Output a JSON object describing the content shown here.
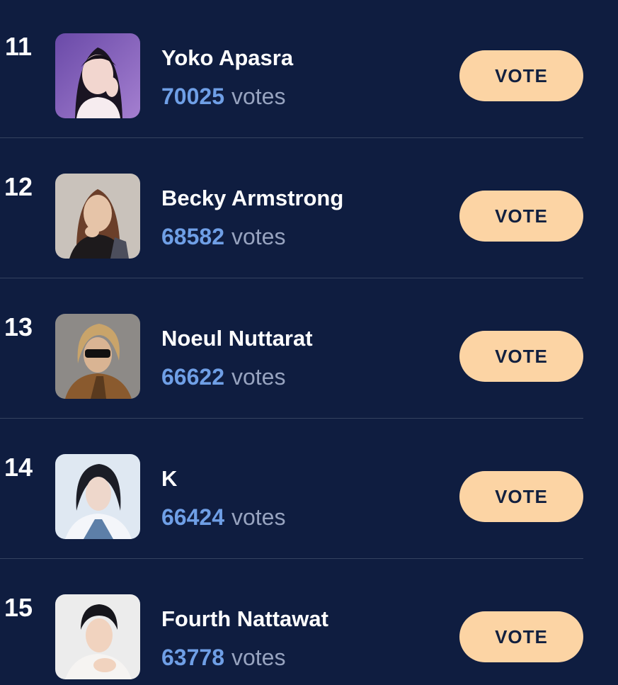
{
  "colors": {
    "background": "#0f1d40",
    "vote_count": "#6f9fe6",
    "vote_unit": "#97a3bf",
    "button_bg": "#fcd4a4",
    "button_text": "#12203f"
  },
  "rows": [
    {
      "rank": "11",
      "name": "Yoko Apasra",
      "votes": "70025",
      "votes_unit": "votes",
      "button_label": "VOTE"
    },
    {
      "rank": "12",
      "name": "Becky Armstrong",
      "votes": "68582",
      "votes_unit": "votes",
      "button_label": "VOTE"
    },
    {
      "rank": "13",
      "name": "Noeul Nuttarat",
      "votes": "66622",
      "votes_unit": "votes",
      "button_label": "VOTE"
    },
    {
      "rank": "14",
      "name": "K",
      "votes": "66424",
      "votes_unit": "votes",
      "button_label": "VOTE"
    },
    {
      "rank": "15",
      "name": "Fourth Nattawat",
      "votes": "63778",
      "votes_unit": "votes",
      "button_label": "VOTE"
    }
  ]
}
